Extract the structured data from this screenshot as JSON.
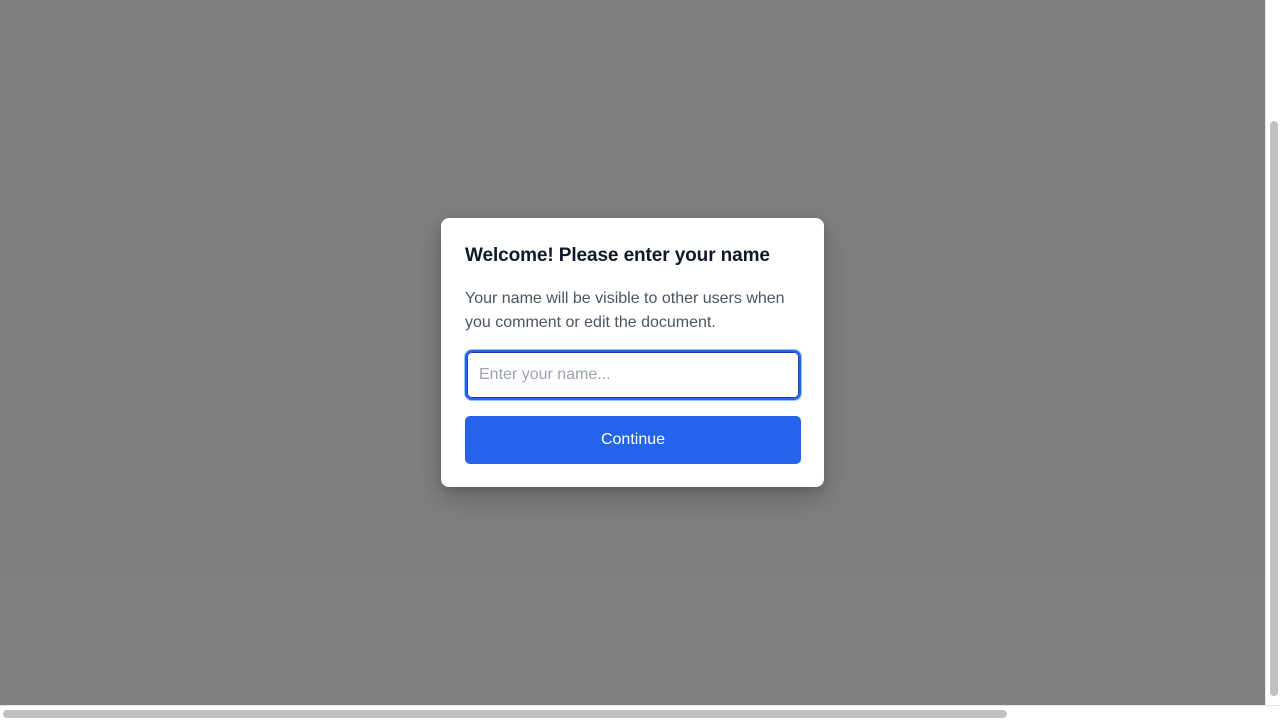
{
  "dialog": {
    "title": "Welcome! Please enter your name",
    "description": "Your name will be visible to other users when you comment or edit the document.",
    "name_input": {
      "value": "",
      "placeholder": "Enter your name..."
    },
    "continue_label": "Continue"
  },
  "colors": {
    "overlay": "#808080",
    "accent": "#2563eb",
    "title_text": "#111827",
    "body_text": "#4b5563",
    "placeholder_text": "#9ca3af"
  }
}
